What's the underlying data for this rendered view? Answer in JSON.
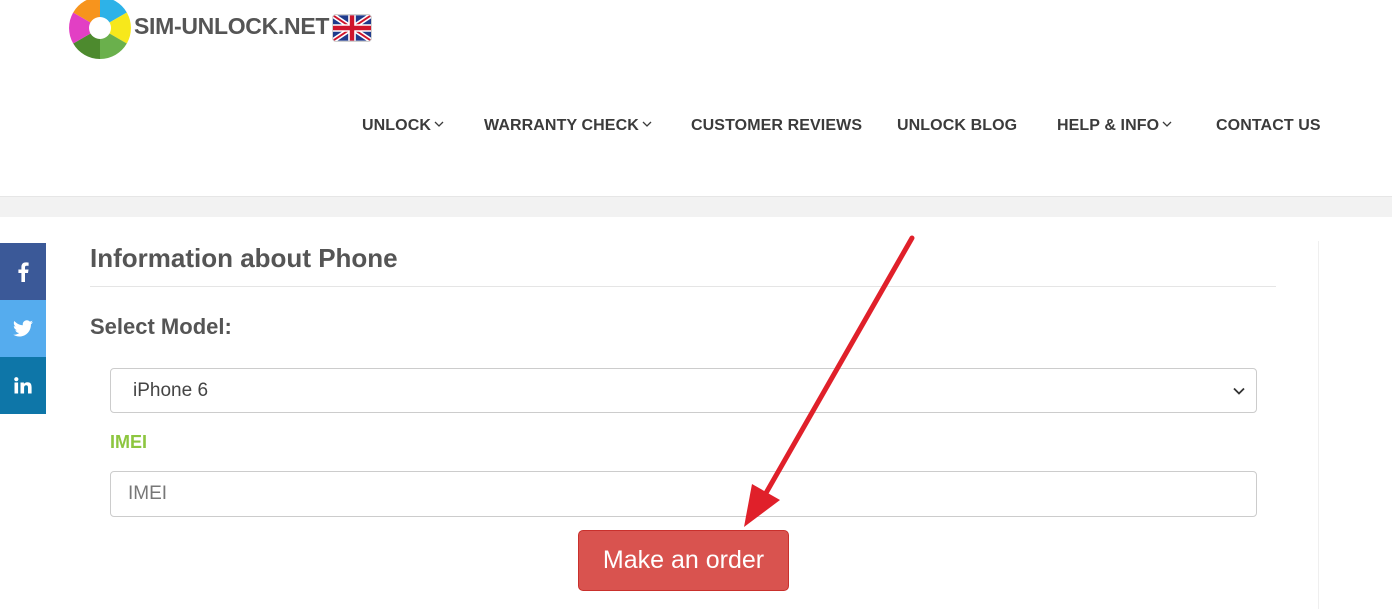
{
  "brand": {
    "name": "SIM-UNLOCK.NET",
    "logo_icon": "aperture-logo-icon",
    "flag_icon": "uk-flag-icon"
  },
  "nav": {
    "items": [
      {
        "label": "UNLOCK",
        "has_dropdown": true
      },
      {
        "label": "WARRANTY CHECK",
        "has_dropdown": true
      },
      {
        "label": "CUSTOMER REVIEWS",
        "has_dropdown": false
      },
      {
        "label": "UNLOCK BLOG",
        "has_dropdown": false
      },
      {
        "label": "HELP & INFO",
        "has_dropdown": true
      },
      {
        "label": "CONTACT US",
        "has_dropdown": false
      }
    ]
  },
  "social": {
    "items": [
      {
        "name": "facebook",
        "icon": "facebook-icon",
        "color": "#3b5998"
      },
      {
        "name": "twitter",
        "icon": "twitter-icon",
        "color": "#55acee"
      },
      {
        "name": "linkedin",
        "icon": "linkedin-icon",
        "color": "#0e76a8"
      }
    ]
  },
  "form": {
    "section_title": "Information about Phone",
    "select_label": "Select Model:",
    "model_value": "iPhone 6",
    "imei_label": "IMEI",
    "imei_placeholder": "IMEI",
    "imei_value": "",
    "submit_label": "Make an order"
  },
  "colors": {
    "accent_green": "#8dc63f",
    "button_red": "#d9534f",
    "annotation_arrow": "#e0202a"
  }
}
